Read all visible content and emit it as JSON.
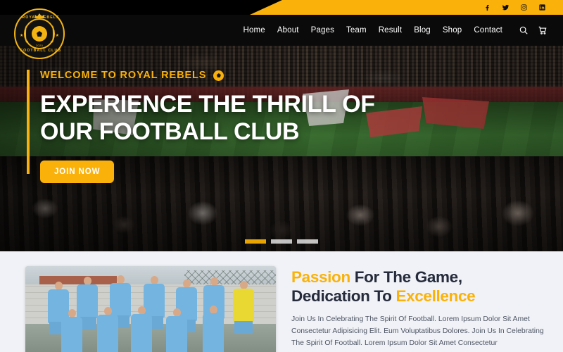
{
  "site": {
    "brand_name": "Royal Rebels",
    "accent_color": "#fab20b",
    "dark_color": "#0a0a0a",
    "page_bg": "#f0f2f7"
  },
  "topbar": {
    "social": [
      {
        "name": "facebook-icon",
        "label": "Facebook"
      },
      {
        "name": "twitter-icon",
        "label": "Twitter"
      },
      {
        "name": "instagram-icon",
        "label": "Instagram"
      },
      {
        "name": "linkedin-icon",
        "label": "LinkedIn"
      }
    ]
  },
  "logo": {
    "text_top": "ROYAL REBELS",
    "text_bottom": "FOOTBALL CLUB",
    "year": "2025"
  },
  "nav": {
    "items": [
      {
        "label": "Home",
        "active": true
      },
      {
        "label": "About",
        "active": false
      },
      {
        "label": "Pages",
        "active": false
      },
      {
        "label": "Team",
        "active": false
      },
      {
        "label": "Result",
        "active": false
      },
      {
        "label": "Blog",
        "active": false
      },
      {
        "label": "Shop",
        "active": false
      },
      {
        "label": "Contact",
        "active": false
      }
    ],
    "search_label": "Search",
    "cart_label": "Cart"
  },
  "hero": {
    "eyebrow": "WELCOME TO ROYAL REBELS",
    "title_line1": "EXPERIENCE THE THRILL OF",
    "title_line2": "OUR FOOTBALL CLUB",
    "cta_label": "JOIN NOW",
    "slides": [
      {
        "index": "1",
        "active": true
      },
      {
        "index": "2",
        "active": false
      },
      {
        "index": "3",
        "active": false
      }
    ]
  },
  "about": {
    "heading_part1": "Passion",
    "heading_part2": " For The Game,",
    "heading_part3": "Dedication To ",
    "heading_part4": "Excellence",
    "paragraph": "Join Us In Celebrating The Spirit Of Football. Lorem Ipsum Dolor Sit Amet Consectetur Adipisicing Elit. Eum Voluptatibus Dolores. Join Us In Celebrating The Spirit Of Football. Lorem Ipsum Dolor Sit Amet Consectetur",
    "photo_alt": "Football team group photo"
  }
}
